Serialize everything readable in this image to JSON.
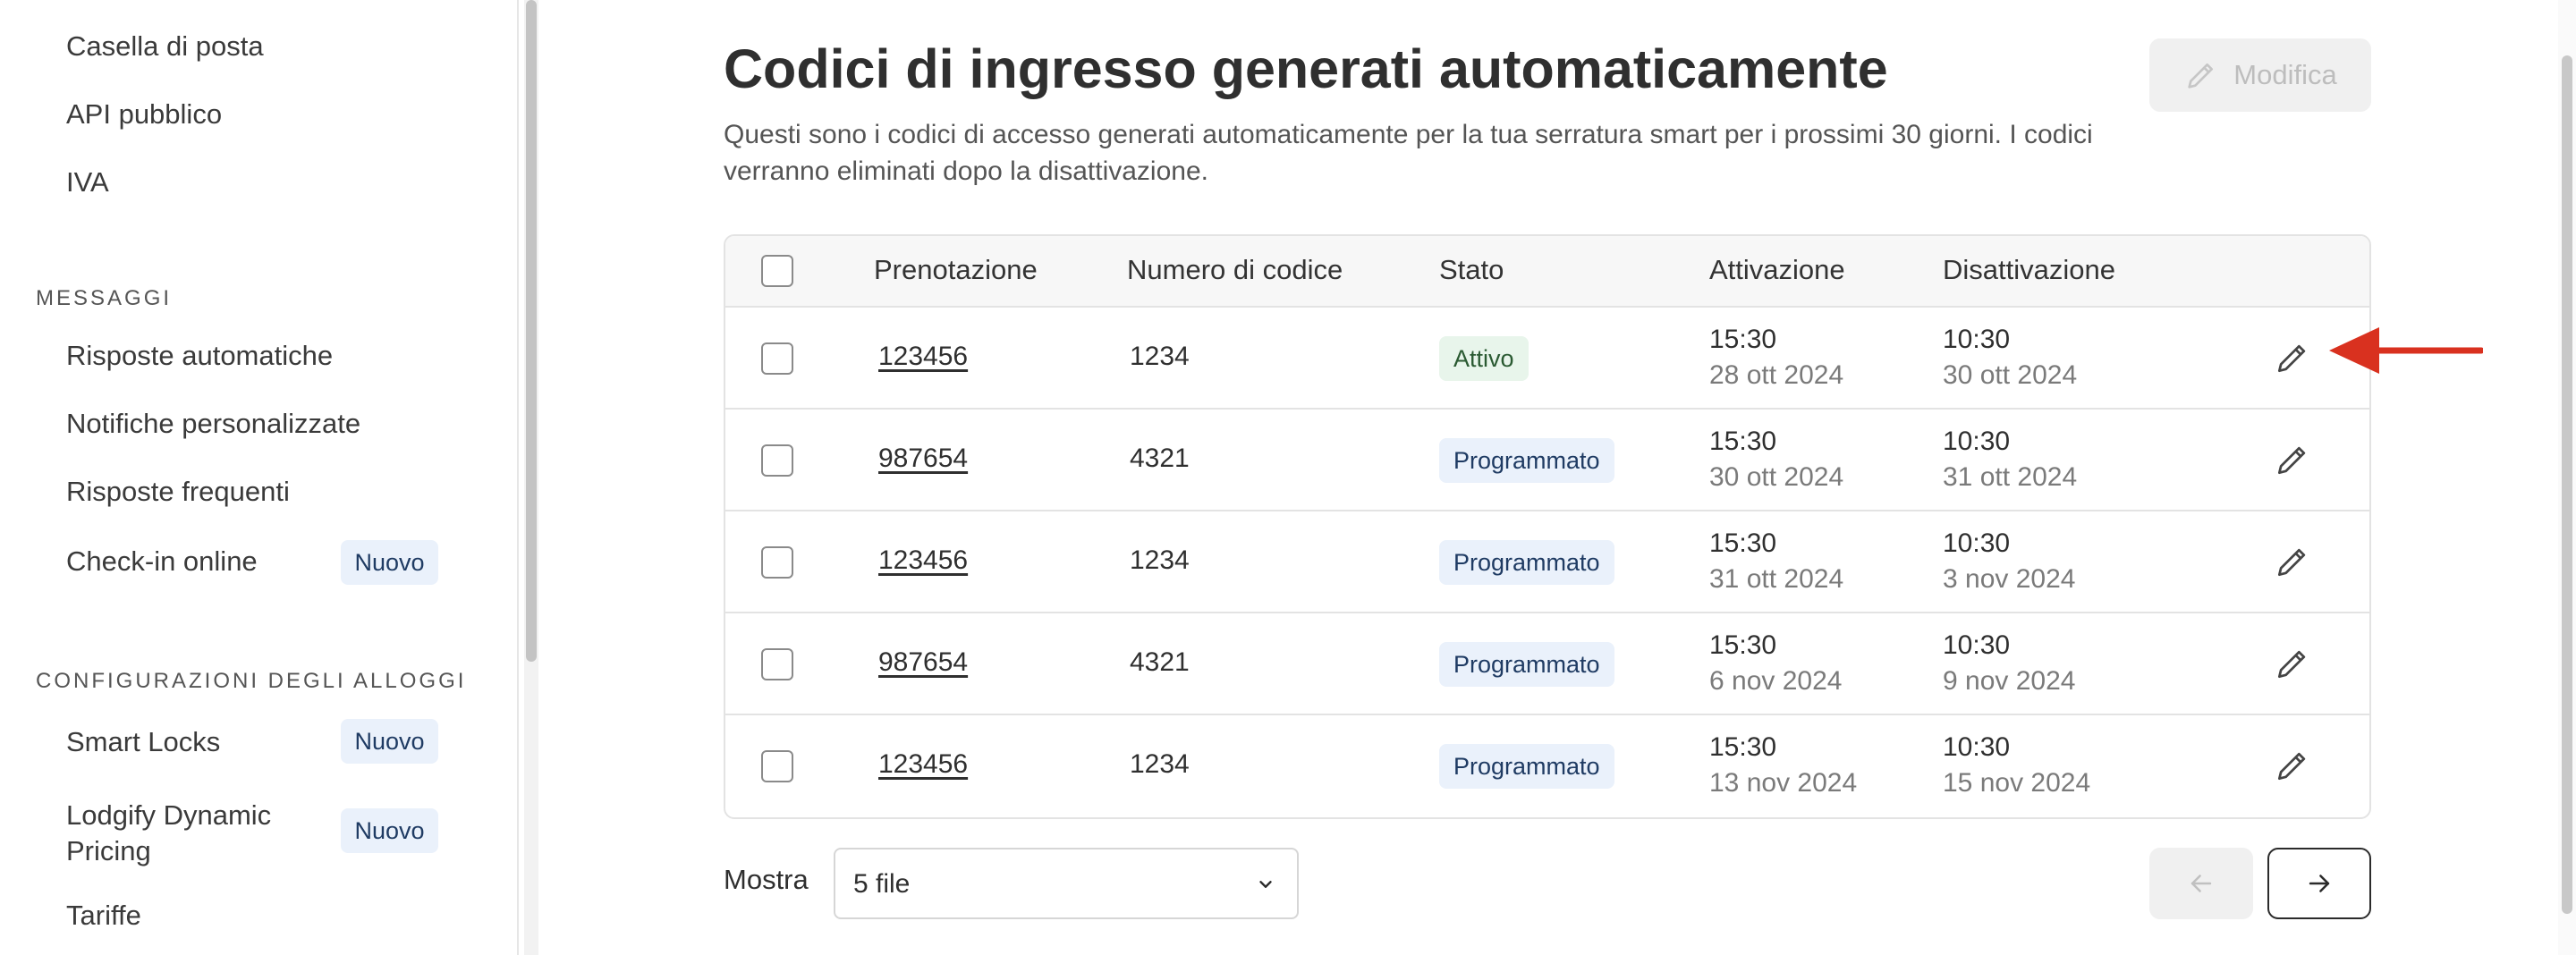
{
  "sidebar": {
    "items_top": [
      {
        "label": "Casella di posta"
      },
      {
        "label": "API pubblico"
      },
      {
        "label": "IVA"
      }
    ],
    "section_messages": "MESSAGGI",
    "messages_items": [
      {
        "label": "Risposte automatiche"
      },
      {
        "label": "Notifiche personalizzate"
      },
      {
        "label": "Risposte frequenti"
      },
      {
        "label": "Check-in online",
        "badge": "Nuovo"
      }
    ],
    "section_config": "CONFIGURAZIONI DEGLI ALLOGGI",
    "config_items": [
      {
        "label": "Smart Locks",
        "badge": "Nuovo"
      },
      {
        "label_line1": "Lodgify Dynamic",
        "label_line2": "Pricing",
        "badge": "Nuovo"
      },
      {
        "label": "Tariffe"
      }
    ]
  },
  "header": {
    "title": "Codici di ingresso generati automaticamente",
    "description": "Questi sono i codici di accesso generati automaticamente per la tua serratura smart per i prossimi 30 giorni. I codici verranno eliminati dopo la disattivazione.",
    "edit_button": "Modifica"
  },
  "table": {
    "columns": [
      "Prenotazione",
      "Numero di codice",
      "Stato",
      "Attivazione",
      "Disattivazione"
    ],
    "rows": [
      {
        "booking": "123456",
        "code": "1234",
        "status": "Attivo",
        "status_type": "active",
        "act_time": "15:30",
        "act_date": "28 ott 2024",
        "deact_time": "10:30",
        "deact_date": "30 ott 2024"
      },
      {
        "booking": "987654",
        "code": "4321",
        "status": "Programmato",
        "status_type": "scheduled",
        "act_time": "15:30",
        "act_date": "30 ott 2024",
        "deact_time": "10:30",
        "deact_date": "31 ott 2024"
      },
      {
        "booking": "123456",
        "code": "1234",
        "status": "Programmato",
        "status_type": "scheduled",
        "act_time": "15:30",
        "act_date": "31 ott 2024",
        "deact_time": "10:30",
        "deact_date": "3 nov 2024"
      },
      {
        "booking": "987654",
        "code": "4321",
        "status": "Programmato",
        "status_type": "scheduled",
        "act_time": "15:30",
        "act_date": "6 nov 2024",
        "deact_time": "10:30",
        "deact_date": "9 nov 2024"
      },
      {
        "booking": "123456",
        "code": "1234",
        "status": "Programmato",
        "status_type": "scheduled",
        "act_time": "15:30",
        "act_date": "13 nov 2024",
        "deact_time": "10:30",
        "deact_date": "15 nov 2024"
      }
    ]
  },
  "footer": {
    "show_label": "Mostra",
    "rows_select_value": "5 file"
  },
  "icons": {
    "row_action": "pencil-icon",
    "annotation": "red-arrow-icon"
  },
  "colors": {
    "annotation_arrow": "#d9311f",
    "status_active_bg": "#e8f5eb",
    "status_scheduled_bg": "#eaf1fb"
  }
}
